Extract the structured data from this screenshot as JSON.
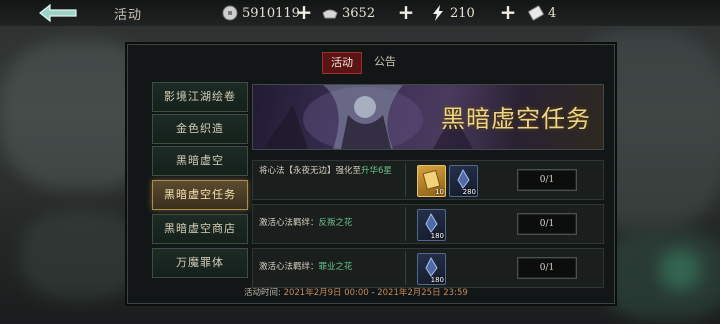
{
  "header": {
    "title": "活动",
    "resources": [
      {
        "icon": "silver-coin-icon",
        "value": "5910119"
      },
      {
        "icon": "ingot-icon",
        "value": "3652"
      },
      {
        "icon": "lightning-icon",
        "value": "210"
      },
      {
        "icon": "ticket-icon",
        "value": "4"
      }
    ],
    "plus": "+"
  },
  "tabs": [
    {
      "label": "活动",
      "active": true
    },
    {
      "label": "公告",
      "active": false
    }
  ],
  "side_menu": [
    {
      "label": "影境江湖绘卷",
      "selected": false
    },
    {
      "label": "金色织造",
      "selected": false
    },
    {
      "label": "黑暗虚空",
      "selected": false
    },
    {
      "label": "黑暗虚空任务",
      "selected": true
    },
    {
      "label": "黑暗虚空商店",
      "selected": false
    },
    {
      "label": "万魔罪体",
      "selected": false
    }
  ],
  "banner": {
    "title": "黑暗虚空任务"
  },
  "tasks": [
    {
      "desc_prefix": "将心法【永夜无边】强化至",
      "desc_highlight": "升华6星",
      "rewards": [
        {
          "icon": "gold-scroll-icon",
          "count": "10",
          "style": "gold"
        },
        {
          "icon": "dark-shard-icon",
          "count": "280",
          "style": "blue"
        }
      ],
      "progress": "0/1"
    },
    {
      "desc_prefix": "激活心法羁绊：",
      "desc_highlight": "反叛之花",
      "rewards": [
        {
          "icon": "dark-shard-icon",
          "count": "180",
          "style": "blue"
        }
      ],
      "progress": "0/1"
    },
    {
      "desc_prefix": "激活心法羁绊：",
      "desc_highlight": "罪业之花",
      "rewards": [
        {
          "icon": "dark-shard-icon",
          "count": "180",
          "style": "blue"
        }
      ],
      "progress": "0/1"
    }
  ],
  "event_time": {
    "label": "活动时间:",
    "start": "2021年2月9日 00:00",
    "separator": "-",
    "end": "2021年2月25日 23:59"
  },
  "colors": {
    "accent_red": "#5a1414",
    "highlight_green": "#68c48a",
    "gold": "#ecd58a"
  }
}
